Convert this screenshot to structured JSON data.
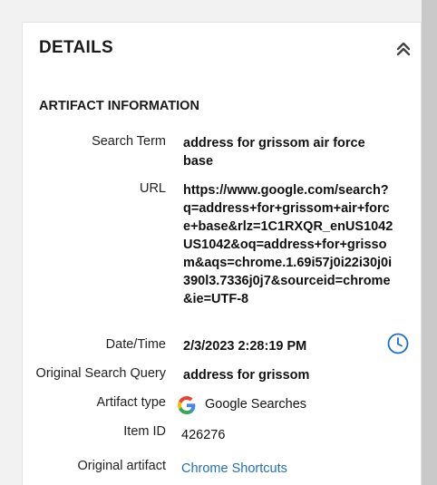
{
  "panel": {
    "title": "DETAILS",
    "collapse_icon": "chevrons-up-icon"
  },
  "section": {
    "title": "ARTIFACT INFORMATION"
  },
  "fields": {
    "search_term": {
      "label": "Search Term",
      "value": "address for grissom air force base"
    },
    "url": {
      "label": "URL",
      "value": "https://www.google.com/search?q=address+for+grissom+air+force+base&rlz=1C1RXQR_enUS1042US1042&oq=address+for+grissom&aqs=chrome.1.69i57j0i22i30j0i390l3.7336j0j7&sourceid=chrome&ie=UTF-8"
    },
    "date_time": {
      "label": "Date/Time",
      "value": "2/3/2023 2:28:19 PM",
      "icon": "clock-icon"
    },
    "original_search_query": {
      "label": "Original Search Query",
      "value": "address for grissom"
    },
    "artifact_type": {
      "label": "Artifact type",
      "value": "Google Searches",
      "icon": "google-icon"
    },
    "item_id": {
      "label": "Item ID",
      "value": "426276"
    },
    "original_artifact": {
      "label": "Original artifact",
      "value": "Chrome Shortcuts"
    }
  },
  "colors": {
    "link": "#1f6fbf",
    "clock": "#1f6fbf"
  }
}
